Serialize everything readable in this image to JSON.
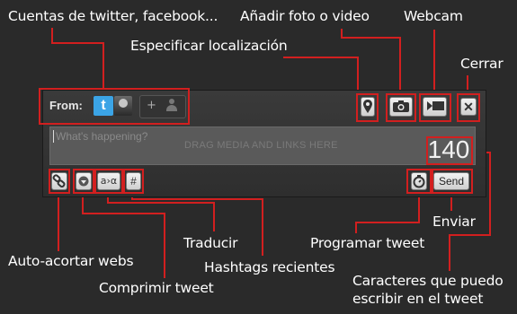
{
  "annotations": {
    "accounts": "Cuentas de twitter, facebook...",
    "add_photo": "Añadir foto o video",
    "webcam": "Webcam",
    "location": "Especificar localización",
    "close": "Cerrar",
    "shorten": "Auto-acortar webs",
    "compress": "Comprimir tweet",
    "translate": "Traducir",
    "hashtags": "Hashtags recientes",
    "schedule": "Programar tweet",
    "send": "Enviar",
    "chars_line1": "Caracteres que puedo",
    "chars_line2": "escribir en el tweet"
  },
  "widget": {
    "from_label": "From:",
    "twitter_account_icon": "t",
    "add_account_plus": "+",
    "compose_placeholder": "What's happening?",
    "drag_hint": "DRAG MEDIA AND LINKS HERE",
    "char_counter": "140",
    "send_label": "Send",
    "translate_label": "a›α",
    "hashtag_label": "#"
  },
  "colors": {
    "background": "#2a2a2a",
    "annotation_red": "#d21f1f",
    "twitter_blue": "#3ba4e6"
  }
}
